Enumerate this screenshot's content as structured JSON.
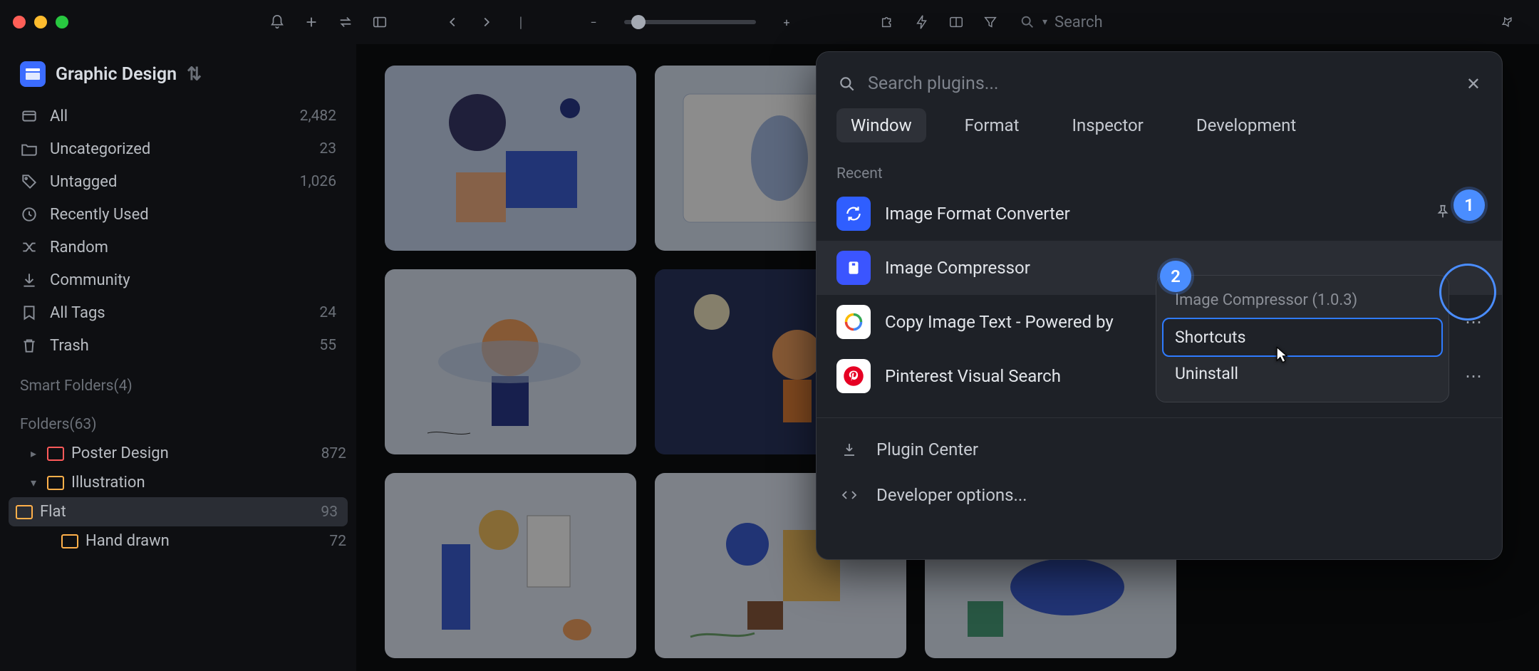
{
  "library_title": "Graphic Design",
  "sidebar": {
    "items": [
      {
        "label": "All",
        "count": "2,482"
      },
      {
        "label": "Uncategorized",
        "count": "23"
      },
      {
        "label": "Untagged",
        "count": "1,026"
      },
      {
        "label": "Recently Used",
        "count": ""
      },
      {
        "label": "Random",
        "count": ""
      },
      {
        "label": "Community",
        "count": ""
      },
      {
        "label": "All Tags",
        "count": "24"
      },
      {
        "label": "Trash",
        "count": "55"
      }
    ],
    "smart_folders_label": "Smart Folders(4)",
    "folders_label": "Folders(63)",
    "folders": [
      {
        "label": "Poster Design",
        "count": "872",
        "color": "red",
        "expanded": false,
        "depth": 0
      },
      {
        "label": "Illustration",
        "count": "",
        "color": "orange",
        "expanded": true,
        "depth": 0
      },
      {
        "label": "Flat",
        "count": "93",
        "color": "orange",
        "depth": 1,
        "selected": true
      },
      {
        "label": "Hand drawn",
        "count": "72",
        "color": "orange",
        "depth": 1
      }
    ]
  },
  "topbar": {
    "search_placeholder": "Search"
  },
  "plugin_panel": {
    "search_placeholder": "Search plugins...",
    "tabs": [
      "Window",
      "Format",
      "Inspector",
      "Development"
    ],
    "active_tab": 0,
    "recent_label": "Recent",
    "items": [
      {
        "label": "Image Format Converter",
        "icon_bg": "#2f5eff",
        "icon": "refresh"
      },
      {
        "label": "Image Compressor",
        "icon_bg": "#3b55ff",
        "icon": "archive",
        "highlighted": true
      },
      {
        "label": "Copy Image Text - Powered by",
        "icon_bg": "#ffffff",
        "icon": "google"
      },
      {
        "label": "Pinterest Visual Search",
        "icon_bg": "#ffffff",
        "icon": "pinterest"
      }
    ],
    "footer": [
      {
        "label": "Plugin Center",
        "icon": "download"
      },
      {
        "label": "Developer options...",
        "icon": "code"
      }
    ]
  },
  "context_menu": {
    "title": "Image Compressor (1.0.3)",
    "items": [
      {
        "label": "Shortcuts",
        "highlighted": true
      },
      {
        "label": "Uninstall"
      }
    ]
  },
  "callouts": {
    "one": "1",
    "two": "2"
  }
}
